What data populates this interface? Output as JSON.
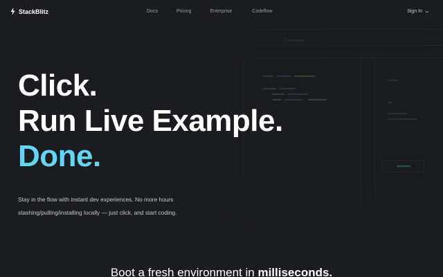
{
  "nav": {
    "brand": "StackBlitz",
    "brand_icon": "bolt-icon",
    "links": [
      "Docs",
      "Pricing",
      "Enterprise",
      "Codeflow"
    ],
    "signin": "Sign In",
    "signin_icon": "chevron-down-icon"
  },
  "hero": {
    "line1": "Click.",
    "line2": "Run Live Example.",
    "line3": "Done.",
    "accent_color": "#62d7f3",
    "lead": "Stay in the flow with instant dev experiences. No more hours stashing/pulling/installing locally — just click, and start coding."
  },
  "boot": {
    "text_before": "Boot a fresh environment in ",
    "text_bold": "milliseconds."
  },
  "colors": {
    "background": "#1b1c1f",
    "text": "#ffffff",
    "muted": "#9a9ca3"
  }
}
